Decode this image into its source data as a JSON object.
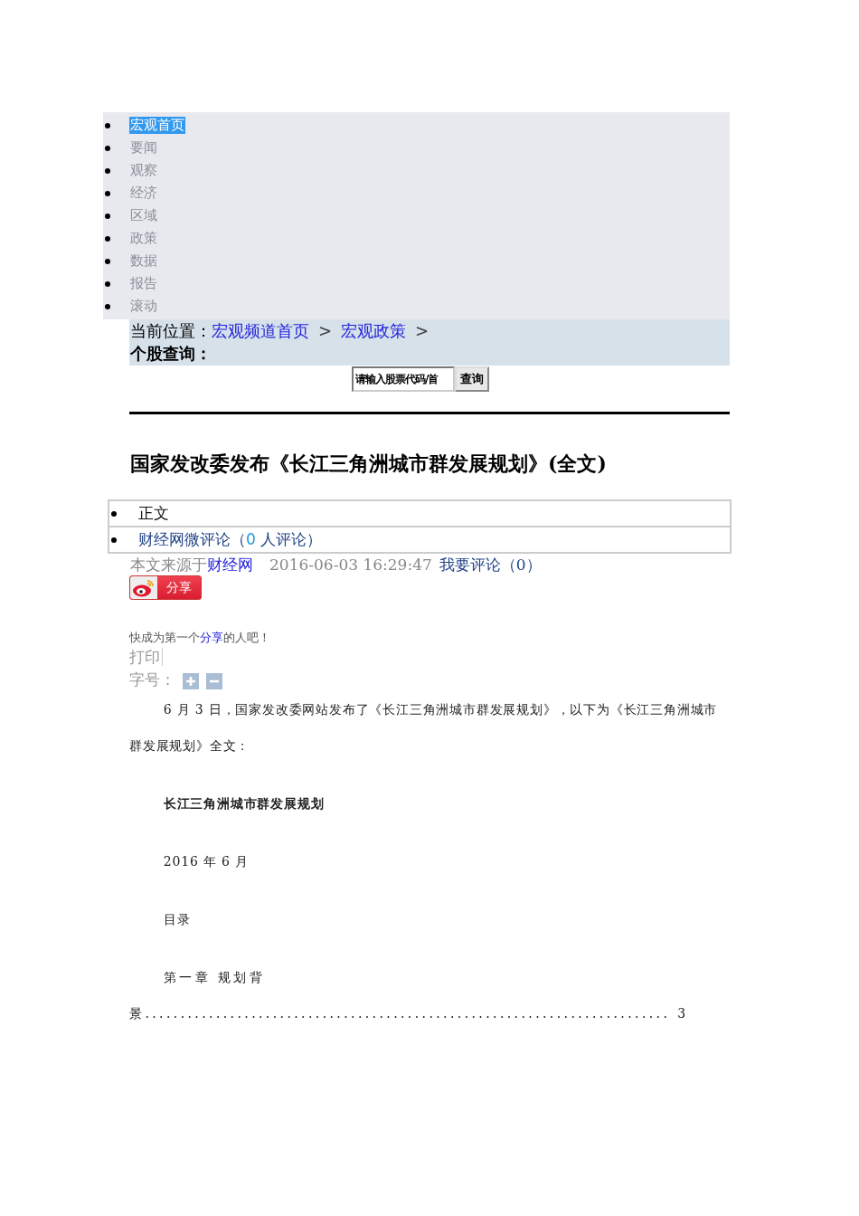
{
  "nav": {
    "items": [
      {
        "label": "宏观首页",
        "selected": true
      },
      {
        "label": "要闻",
        "selected": false
      },
      {
        "label": "观察",
        "selected": false
      },
      {
        "label": "经济",
        "selected": false
      },
      {
        "label": "区域",
        "selected": false
      },
      {
        "label": "政策",
        "selected": false
      },
      {
        "label": "数据",
        "selected": false
      },
      {
        "label": "报告",
        "selected": false
      },
      {
        "label": "滚动",
        "selected": false
      }
    ]
  },
  "breadcrumb": {
    "label": "当前位置：",
    "links": [
      {
        "label": "宏观频道首页",
        "separator": ">"
      },
      {
        "label": "宏观政策",
        "separator": ">"
      }
    ]
  },
  "stock_search": {
    "label": "个股查询：",
    "value": "请输入股票代码/首",
    "button": "查询"
  },
  "title": "国家发改委发布《长江三角洲城市群发展规划》(全文)",
  "tabs": [
    {
      "label": "正文",
      "kind": "plain"
    },
    {
      "label": "财经网微评论（",
      "count": "0",
      "suffix": " 人评论）",
      "kind": "comments"
    }
  ],
  "meta": {
    "source_label": "本文来源于",
    "source_link": "财经网",
    "datetime": "2016-06-03 16:29:47",
    "comment_link": "我要评论（0）"
  },
  "share_button": "分享",
  "share_prompt": {
    "before": "快成为第一个",
    "link": "分享",
    "after": "的人吧！"
  },
  "print": "打印",
  "font_size": {
    "label": "字号："
  },
  "body": [
    {
      "kind": "paragraph",
      "text": "6 月 3 日，国家发改委网站发布了《长江三角洲城市群发展规划》，以下为《长江三角洲城市群发展规划》全文："
    },
    {
      "kind": "heading",
      "text": "长江三角洲城市群发展规划"
    },
    {
      "kind": "line",
      "text": "2016  年  6  月"
    },
    {
      "kind": "line",
      "text": "目录"
    },
    {
      "kind": "toc",
      "text": "第一章  规划背景",
      "leader": "..........................................................................",
      "page": "3"
    }
  ]
}
